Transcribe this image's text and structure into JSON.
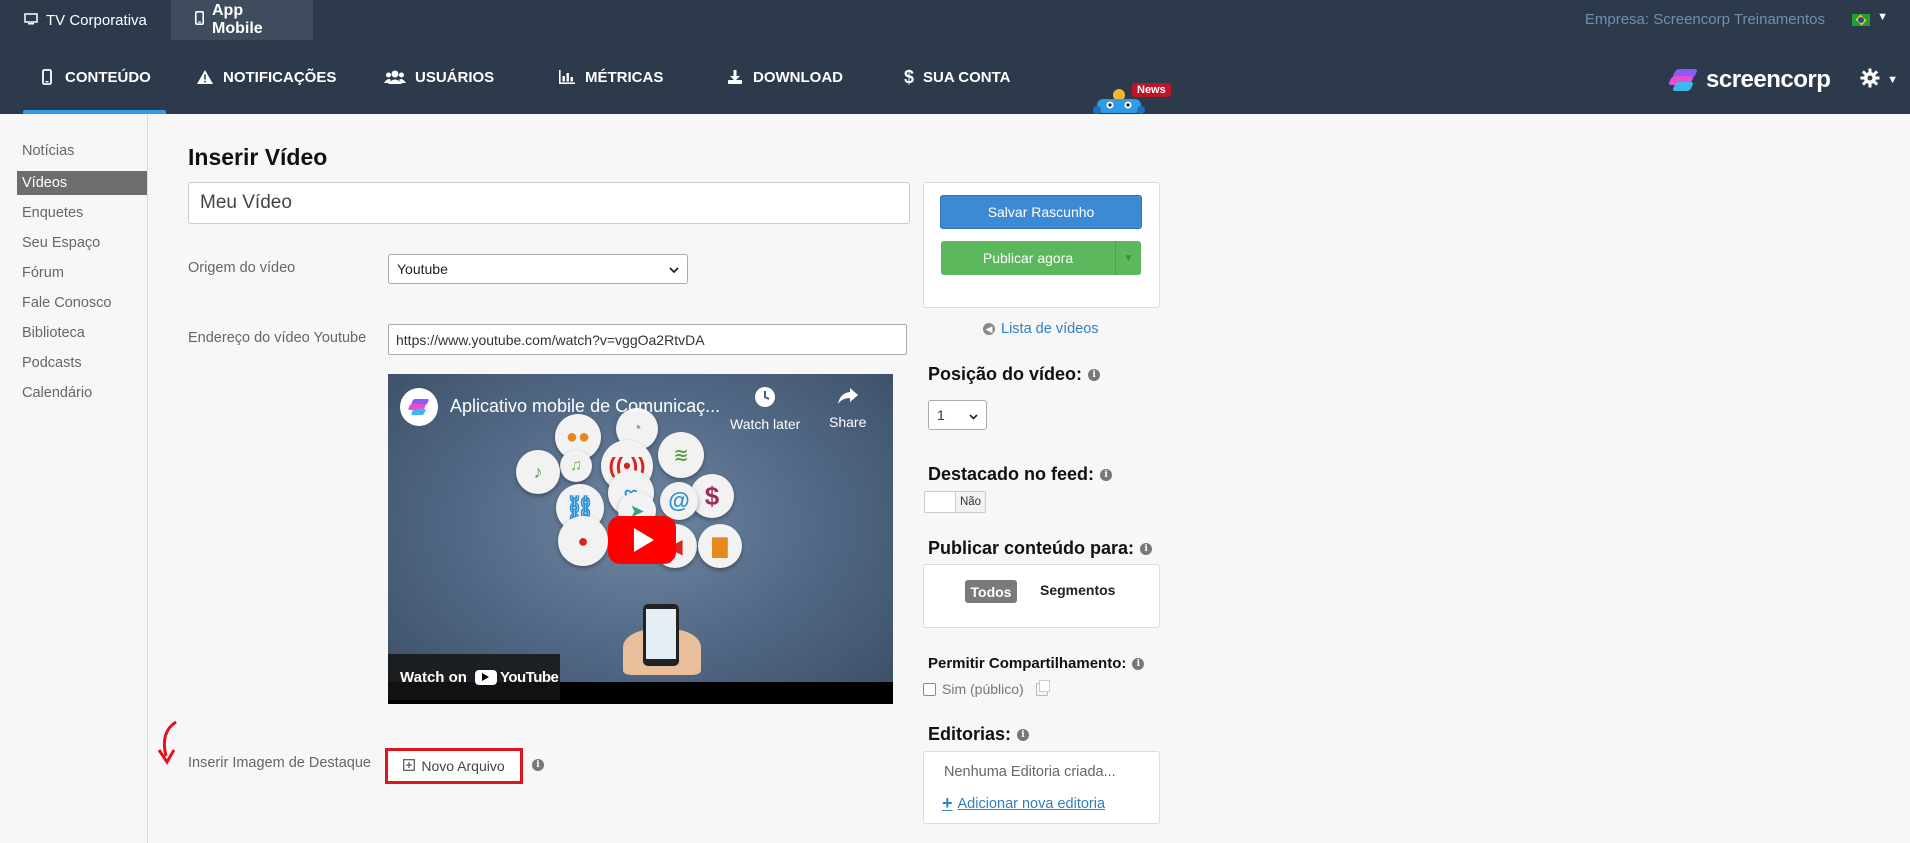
{
  "topbar": {
    "tabs": [
      {
        "label": "TV Corporativa",
        "icon": "monitor-icon"
      },
      {
        "label": "App Mobile",
        "icon": "phone-icon"
      }
    ],
    "company": "Empresa: Screencorp Treinamentos"
  },
  "nav": {
    "items": [
      {
        "label": "CONTEÚDO",
        "icon": "phone-icon"
      },
      {
        "label": "NOTIFICAÇÕES",
        "icon": "warning-icon"
      },
      {
        "label": "USUÁRIOS",
        "icon": "users-icon"
      },
      {
        "label": "MÉTRICAS",
        "icon": "bar-chart-icon"
      },
      {
        "label": "DOWNLOAD",
        "icon": "download-icon"
      },
      {
        "label": "SUA CONTA",
        "icon": "dollar-icon"
      }
    ],
    "news_badge": "News",
    "logo_text": "screencorp"
  },
  "sidebar": {
    "items": [
      "Notícias",
      "Vídeos",
      "Enquetes",
      "Seu Espaço",
      "Fórum",
      "Fale Conosco",
      "Biblioteca",
      "Podcasts",
      "Calendário"
    ]
  },
  "form": {
    "page_title": "Inserir Vídeo",
    "title_value": "Meu Vídeo",
    "origin_label": "Origem do vídeo",
    "origin_value": "Youtube",
    "url_label": "Endereço do vídeo Youtube",
    "url_value": "https://www.youtube.com/watch?v=vggOa2RtvDA",
    "featured_label": "Inserir Imagem de Destaque",
    "new_file_label": "Novo Arquivo"
  },
  "video": {
    "title": "Aplicativo mobile de Comunicaç...",
    "watch_later": "Watch later",
    "share": "Share",
    "watch_on": "Watch on",
    "youtube": "YouTube"
  },
  "panel": {
    "save_draft": "Salvar Rascunho",
    "publish_now": "Publicar agora",
    "video_list": "Lista de vídeos",
    "position_title": "Posição do vídeo:",
    "position_value": "1",
    "featured_title": "Destacado no feed:",
    "featured_value": "Não",
    "publish_for_title": "Publicar conteúdo para:",
    "audience_all": "Todos",
    "audience_segments": "Segmentos",
    "share_title": "Permitir Compartilhamento:",
    "share_option": "Sim (público)",
    "editorias_title": "Editorias:",
    "editorias_empty": "Nenhuma Editoria criada...",
    "add_editoria": "Adicionar nova editoria"
  },
  "colors": {
    "header_bg": "#2c3a4c",
    "accent_blue": "#3d8ad4",
    "publish_green": "#5cb85c",
    "highlight_red": "#e0141e"
  }
}
